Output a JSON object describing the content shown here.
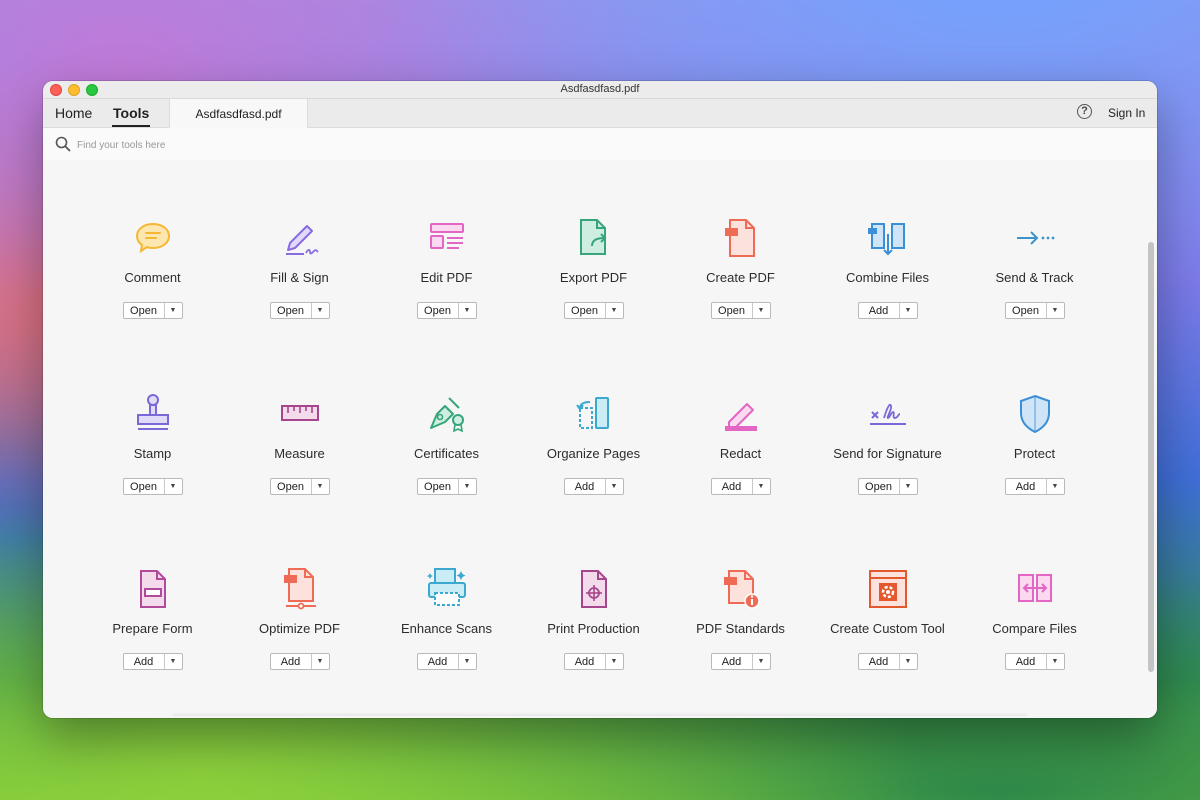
{
  "window": {
    "title": "Asdfasdfasd.pdf"
  },
  "tabs": {
    "home": "Home",
    "tools": "Tools",
    "document": "Asdfasdfasd.pdf"
  },
  "header": {
    "help_icon": "?",
    "sign_in": "Sign In"
  },
  "search": {
    "placeholder": "Find your tools here",
    "value": ""
  },
  "tools": [
    {
      "id": "comment",
      "label": "Comment",
      "action": "Open",
      "icon": "comment-icon",
      "color": "#f5b731"
    },
    {
      "id": "fill-sign",
      "label": "Fill & Sign",
      "action": "Open",
      "icon": "fill-sign-icon",
      "color": "#8b6be0"
    },
    {
      "id": "edit-pdf",
      "label": "Edit PDF",
      "action": "Open",
      "icon": "edit-pdf-icon",
      "color": "#e466c4"
    },
    {
      "id": "export-pdf",
      "label": "Export PDF",
      "action": "Open",
      "icon": "export-pdf-icon",
      "color": "#36a67a"
    },
    {
      "id": "create-pdf",
      "label": "Create PDF",
      "action": "Open",
      "icon": "create-pdf-icon",
      "color": "#ee6b55"
    },
    {
      "id": "combine-files",
      "label": "Combine Files",
      "action": "Add",
      "icon": "combine-files-icon",
      "color": "#3b8fd6"
    },
    {
      "id": "send-track",
      "label": "Send & Track",
      "action": "Open",
      "icon": "send-track-icon",
      "color": "#3c94c8"
    },
    {
      "id": "stamp",
      "label": "Stamp",
      "action": "Open",
      "icon": "stamp-icon",
      "color": "#7a68d8"
    },
    {
      "id": "measure",
      "label": "Measure",
      "action": "Open",
      "icon": "measure-icon",
      "color": "#a6468c"
    },
    {
      "id": "certificates",
      "label": "Certificates",
      "action": "Open",
      "icon": "certificates-icon",
      "color": "#36a67a"
    },
    {
      "id": "organize-pages",
      "label": "Organize Pages",
      "action": "Add",
      "icon": "organize-pages-icon",
      "color": "#3aa8cf"
    },
    {
      "id": "redact",
      "label": "Redact",
      "action": "Add",
      "icon": "redact-icon",
      "color": "#e466c4"
    },
    {
      "id": "send-signature",
      "label": "Send for Signature",
      "action": "Open",
      "icon": "send-signature-icon",
      "color": "#7a68d8"
    },
    {
      "id": "protect",
      "label": "Protect",
      "action": "Add",
      "icon": "protect-icon",
      "color": "#3b8fd6"
    },
    {
      "id": "prepare-form",
      "label": "Prepare Form",
      "action": "Add",
      "icon": "prepare-form-icon",
      "color": "#b24a9c"
    },
    {
      "id": "optimize-pdf",
      "label": "Optimize PDF",
      "action": "Add",
      "icon": "optimize-pdf-icon",
      "color": "#ee6b55"
    },
    {
      "id": "enhance-scans",
      "label": "Enhance Scans",
      "action": "Add",
      "icon": "enhance-scans-icon",
      "color": "#3aa8cf"
    },
    {
      "id": "print-production",
      "label": "Print Production",
      "action": "Add",
      "icon": "print-production-icon",
      "color": "#a6468c"
    },
    {
      "id": "pdf-standards",
      "label": "PDF Standards",
      "action": "Add",
      "icon": "pdf-standards-icon",
      "color": "#ee6b55"
    },
    {
      "id": "create-custom-tool",
      "label": "Create Custom Tool",
      "action": "Add",
      "icon": "create-custom-tool-icon",
      "color": "#e4582e"
    },
    {
      "id": "compare-files",
      "label": "Compare Files",
      "action": "Add",
      "icon": "compare-files-icon",
      "color": "#e466c4"
    }
  ]
}
